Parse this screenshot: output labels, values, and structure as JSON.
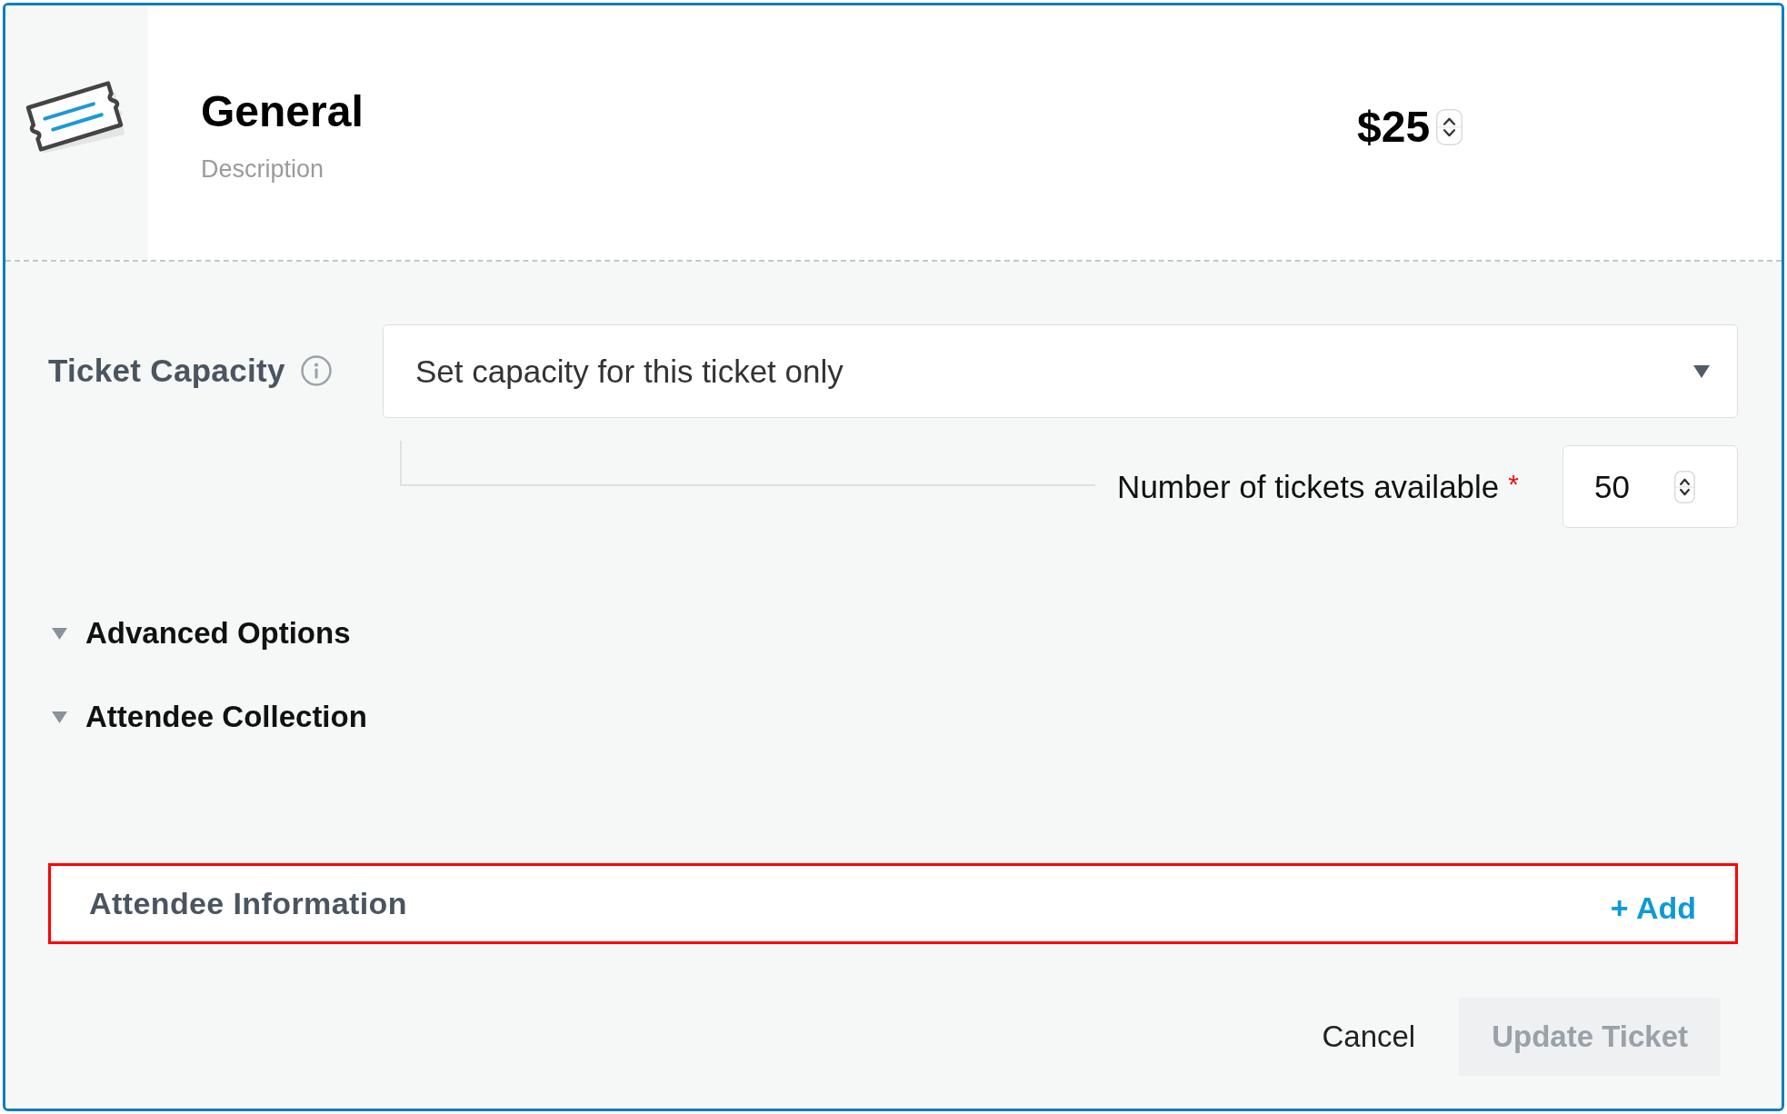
{
  "ticket": {
    "name": "General",
    "description": "Description",
    "price": "$25"
  },
  "capacity": {
    "label": "Ticket Capacity",
    "select": {
      "value": "Set capacity for this ticket only"
    },
    "available": {
      "label": "Number of tickets available",
      "required_mark": "*",
      "value": "50"
    }
  },
  "sections": [
    {
      "label": "Advanced Options",
      "expanded": false
    },
    {
      "label": "Attendee Collection",
      "expanded": false
    }
  ],
  "attendee_information": {
    "label": "Attendee Information",
    "action": "+ Add",
    "highlighted": true
  },
  "buttons": [
    {
      "label": "Cancel",
      "kind": "link",
      "disabled": false
    },
    {
      "label": "Update Ticket",
      "kind": "primary",
      "disabled": true
    }
  ]
}
